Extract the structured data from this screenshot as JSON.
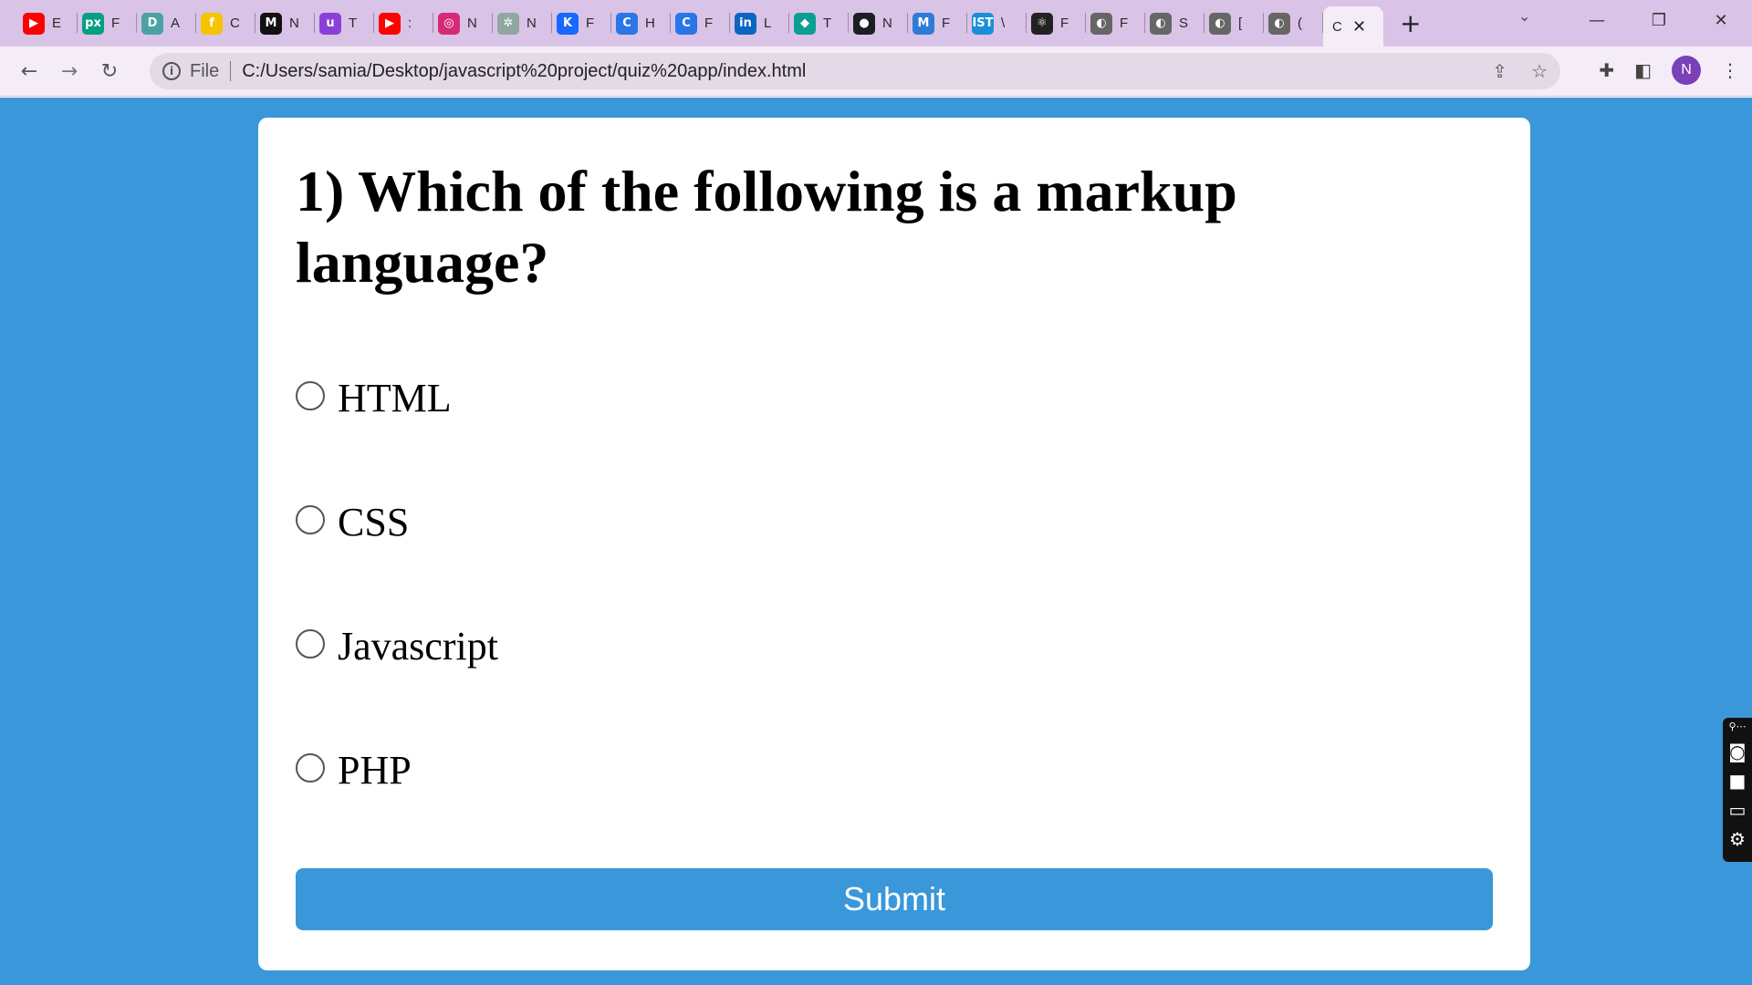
{
  "browser": {
    "tabs": [
      {
        "icon": "youtube-icon",
        "glyph": "▶",
        "color": "#ff0000",
        "title": "E"
      },
      {
        "icon": "pexels-icon",
        "glyph": "px",
        "color": "#05a081",
        "title": "F"
      },
      {
        "icon": "d-app-icon",
        "glyph": "D",
        "color": "#4aa3a3",
        "title": "A"
      },
      {
        "icon": "flipkart-icon",
        "glyph": "f",
        "color": "#f5c400",
        "title": "C"
      },
      {
        "icon": "m-app-icon",
        "glyph": "M",
        "color": "#111111",
        "title": "N"
      },
      {
        "icon": "u-app-icon",
        "glyph": "u",
        "color": "#8b3fd9",
        "title": "T"
      },
      {
        "icon": "youtube-icon",
        "glyph": "▶",
        "color": "#ff0000",
        "title": ":"
      },
      {
        "icon": "instagram-icon",
        "glyph": "◎",
        "color": "#d62976",
        "title": "N"
      },
      {
        "icon": "chatgpt-icon",
        "glyph": "✲",
        "color": "#8fa8a0",
        "title": "N"
      },
      {
        "icon": "k-app-icon",
        "glyph": "K",
        "color": "#1769ff",
        "title": "F"
      },
      {
        "icon": "c-app-icon",
        "glyph": "C",
        "color": "#2a76e8",
        "title": "H"
      },
      {
        "icon": "c-app-icon",
        "glyph": "C",
        "color": "#2a76e8",
        "title": "F"
      },
      {
        "icon": "linkedin-icon",
        "glyph": "in",
        "color": "#0a66c2",
        "title": "L"
      },
      {
        "icon": "diamond-icon",
        "glyph": "◆",
        "color": "#0d9e93",
        "title": "T"
      },
      {
        "icon": "github-icon",
        "glyph": "●",
        "color": "#1b1f23",
        "title": "N"
      },
      {
        "icon": "mui-icon",
        "glyph": "M",
        "color": "#2f7bd8",
        "title": "F"
      },
      {
        "icon": "ist-icon",
        "glyph": "IST",
        "color": "#1a8fd6",
        "title": "\\"
      },
      {
        "icon": "react-icon",
        "glyph": "⚛",
        "color": "#222222",
        "title": "F"
      },
      {
        "icon": "globe-icon",
        "glyph": "◐",
        "color": "#666666",
        "title": "F"
      },
      {
        "icon": "globe-icon",
        "glyph": "◐",
        "color": "#666666",
        "title": "S"
      },
      {
        "icon": "globe-icon",
        "glyph": "◐",
        "color": "#666666",
        "title": "["
      },
      {
        "icon": "globe-icon",
        "glyph": "◐",
        "color": "#666666",
        "title": "("
      }
    ],
    "active_tab": {
      "title": "C",
      "close": "✕"
    },
    "new_tab": "+",
    "address": {
      "scheme_label": "File",
      "url": "C:/Users/samia/Desktop/javascript%20project/quiz%20app/index.html"
    },
    "profile_initial": "N"
  },
  "quiz": {
    "question": "1) Which of the following is a markup language?",
    "answers": [
      {
        "label": "HTML"
      },
      {
        "label": "CSS"
      },
      {
        "label": "Javascript"
      },
      {
        "label": "PHP"
      }
    ],
    "submit_label": "Submit"
  },
  "colors": {
    "page_bg": "#3a97d9",
    "button_bg": "#3a97d9",
    "chrome_frame": "#d9c3e6"
  }
}
